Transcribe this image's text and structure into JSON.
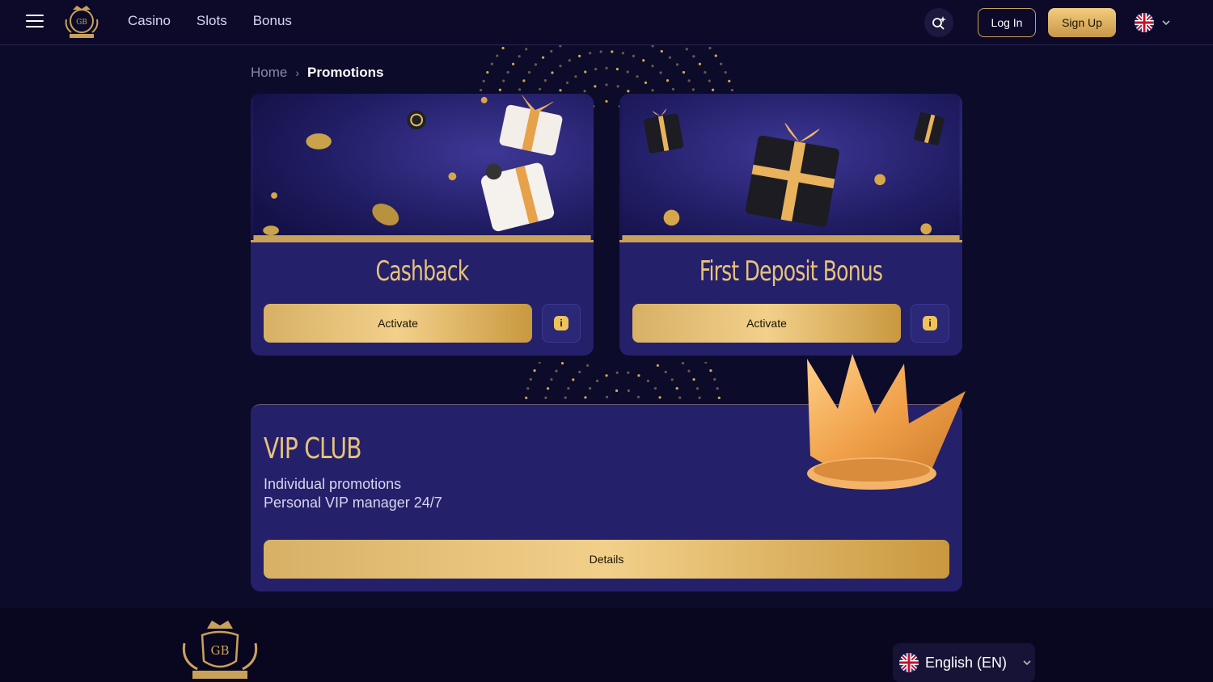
{
  "header": {
    "nav": [
      "Casino",
      "Slots",
      "Bonus"
    ],
    "login_label": "Log In",
    "signup_label": "Sign Up"
  },
  "breadcrumb": {
    "home": "Home",
    "current": "Promotions"
  },
  "promos": [
    {
      "title": "Cashback",
      "button": "Activate",
      "info_icon": "i"
    },
    {
      "title": "First Deposit Bonus",
      "button": "Activate",
      "info_icon": "i"
    }
  ],
  "vip": {
    "title": "VIP CLUB",
    "line1": "Individual promotions",
    "line2": "Personal VIP manager 24/7",
    "button": "Details"
  },
  "footer": {
    "language": "English (EN)"
  },
  "colors": {
    "background": "#0d0b2a",
    "card": "#24206a",
    "gold": "#e8c27a",
    "gold_button": "#f2d08a"
  }
}
